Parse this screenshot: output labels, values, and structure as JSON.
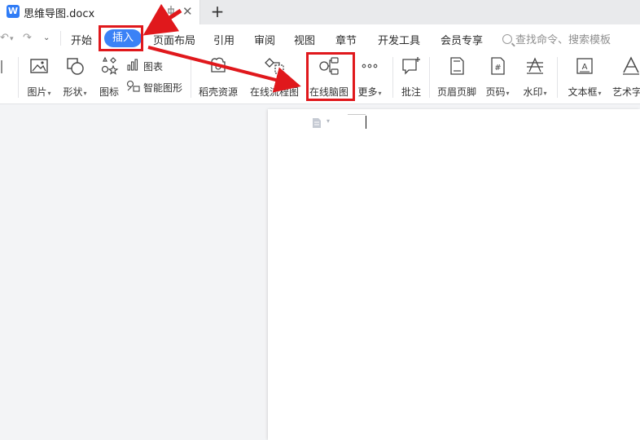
{
  "titlebar": {
    "doc_title": "思维导图.docx",
    "new_tab_symbol": "+"
  },
  "menu": {
    "items": [
      "开始",
      "插入",
      "页面布局",
      "引用",
      "审阅",
      "视图",
      "章节",
      "开发工具",
      "会员专享"
    ],
    "active_index": 1,
    "search_placeholder": "查找命令、搜索模板"
  },
  "ribbon": {
    "picture": "图片",
    "shape": "形状",
    "icon": "图标",
    "chart": "图表",
    "smart_graphic": "智能图形",
    "docer_resources": "稻壳资源",
    "online_flowchart": "在线流程图",
    "online_mindmap": "在线脑图",
    "more": "更多",
    "comment": "批注",
    "header_footer": "页眉页脚",
    "page_number": "页码",
    "watermark": "水印",
    "text_box": "文本框",
    "art_text": "艺术字"
  },
  "colors": {
    "accent": "#3b82f6",
    "annotation_red": "#e0181c"
  }
}
